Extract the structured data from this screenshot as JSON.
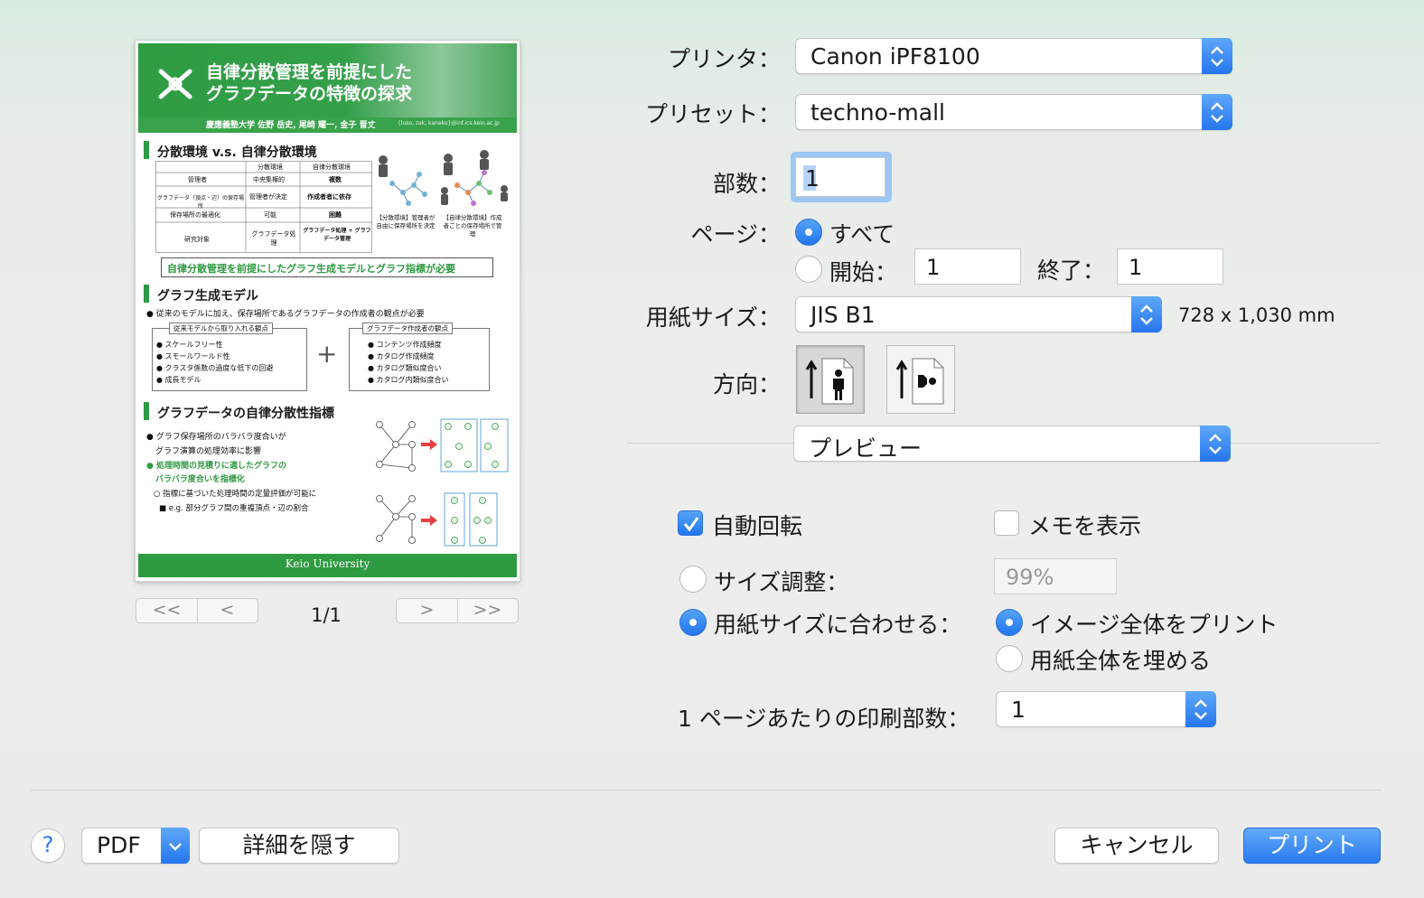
{
  "preview": {
    "poster": {
      "title_line1": "自律分散管理を前提にした",
      "title_line2": "グラフデータの特徴の探求",
      "authors": "慶應義塾大学 佐野 岳史, 尾崎 耀一, 金子 晋丈",
      "emails": "{luso, zak, kaneko}@inf.ics.keio.ac.jp",
      "section1_title": "分散環境 v.s. 自律分散環境",
      "table": {
        "headers": [
          "",
          "分散環境",
          "自律分散環境"
        ],
        "rows": [
          [
            "管理者",
            "中央集権的",
            "複数"
          ],
          [
            "グラフデータ（頂点・辺）の保存場所",
            "管理者が決定",
            "作成者者に依存"
          ],
          [
            "保存場所の最適化",
            "可能",
            "困難"
          ],
          [
            "研究対象",
            "グラフデータ処理",
            "グラフデータ処理 + グラフデータ管理"
          ]
        ]
      },
      "caption_left": "【分散環境】管理者が自由に保存場所を決定",
      "caption_right": "【自律分散環境】作成者ごとの保存場所で管理",
      "callout": "自律分散管理を前提にしたグラフ生成モデルとグラフ指標が必要",
      "section2_title": "グラフ生成モデル",
      "section2_bullet": "● 従来のモデルに加え、保存場所であるグラフデータの作成者の観点が必要",
      "box1_title": "従来モデルから取り入れる観点",
      "box1_items": [
        "● スケールフリー性",
        "● スモールワールド性",
        "● クラスタ係数の過度な低下の回避",
        "● 成長モデル"
      ],
      "box2_title": "グラフデータ作成者の観点",
      "box2_items": [
        "● コンテンツ作成頻度",
        "● カタログ作成頻度",
        "● カタログ類似度合い",
        "● カタログ内類似度合い"
      ],
      "plus": "+",
      "section3_title": "グラフデータの自律分散性指標",
      "section3_lines": [
        "● グラフ保存場所のバラバラ度合いが",
        "グラフ演算の処理効率に影響",
        "● 処理時間の見積りに適したグラフの",
        "バラバラ度合いを指標化",
        "○ 指標に基づいた処理時間の定量評価が可能に",
        "■ e.g. 部分グラフ間の重複頂点・辺の割合"
      ],
      "footer": "Keio University"
    },
    "nav": {
      "first": "<<",
      "prev": "<",
      "next": ">",
      "last": ">>"
    },
    "page_indicator": "1/1"
  },
  "form": {
    "printer_label": "プリンタ：",
    "printer_value": "Canon iPF8100",
    "preset_label": "プリセット：",
    "preset_value": "techno-mall",
    "copies_label": "部数：",
    "copies_value": "1",
    "pages_label": "ページ：",
    "pages_all": "すべて",
    "pages_from": "開始：",
    "pages_from_value": "1",
    "pages_to": "終了：",
    "pages_to_value": "1",
    "paper_label": "用紙サイズ：",
    "paper_value": "JIS B1",
    "paper_dims": "728 x 1,030 mm",
    "orientation_label": "方向：",
    "section_popup": "プレビュー",
    "auto_rotate": "自動回転",
    "show_notes": "メモを表示",
    "scale_label": "サイズ調整：",
    "scale_placeholder": "99%",
    "fit_label": "用紙サイズに合わせる：",
    "fit_entire": "イメージ全体をプリント",
    "fill_paper": "用紙全体を埋める",
    "copies_per_page_label": "1 ページあたりの印刷部数：",
    "copies_per_page_value": "1"
  },
  "footer": {
    "help": "?",
    "pdf": "PDF",
    "hide_details": "詳細を隠す",
    "cancel": "キャンセル",
    "print": "プリント"
  },
  "colors": {
    "accent": "#2576ee",
    "poster_green": "#2e9a41"
  }
}
